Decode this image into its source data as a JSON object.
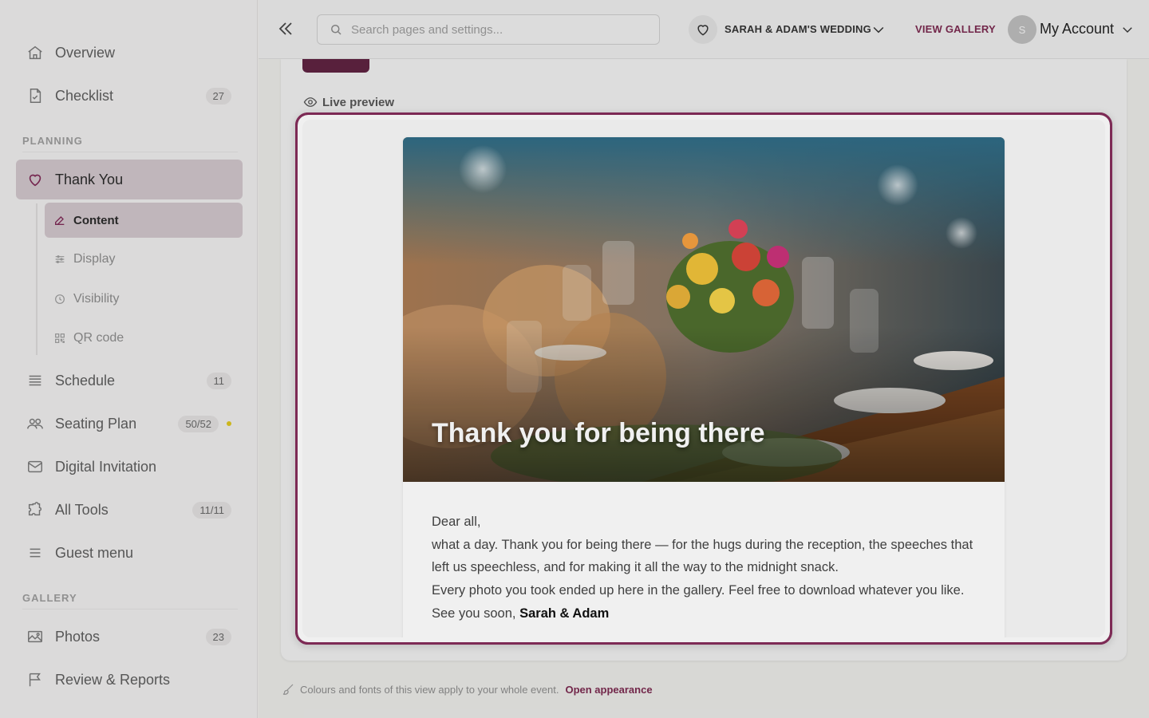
{
  "sidebar": {
    "items": [
      {
        "label": "Overview",
        "icon": "home-icon"
      },
      {
        "label": "Checklist",
        "icon": "checklist-icon",
        "badge": "27"
      },
      {
        "label": "Thank You",
        "icon": "heart-icon"
      },
      {
        "label": "Schedule",
        "icon": "list-icon",
        "badge": "11"
      },
      {
        "label": "Seating Plan",
        "icon": "people-icon",
        "badge": "50/52"
      },
      {
        "label": "Digital Invitation",
        "icon": "envelope-icon"
      },
      {
        "label": "All Tools",
        "icon": "puzzle-icon",
        "badge": "11/11"
      },
      {
        "label": "Guest menu",
        "icon": "menu-icon"
      },
      {
        "label": "Photos",
        "icon": "image-icon",
        "badge": "23"
      },
      {
        "label": "Review & Reports",
        "icon": "flag-icon"
      }
    ],
    "sections": {
      "planning": "PLANNING",
      "gallery": "GALLERY"
    },
    "sub_items": [
      {
        "label": "Content",
        "icon": "edit-icon"
      },
      {
        "label": "Display",
        "icon": "sliders-icon"
      },
      {
        "label": "Visibility",
        "icon": "clock-icon"
      },
      {
        "label": "QR code",
        "icon": "qr-icon"
      }
    ]
  },
  "topbar": {
    "search_placeholder": "Search pages and settings...",
    "event_name": "SARAH & ADAM'S WEDDING",
    "view_gallery": "VIEW GALLERY",
    "avatar_initial": "S",
    "account_label": "My Account"
  },
  "preview": {
    "label": "Live preview",
    "hero_title": "Thank you for being there",
    "greeting": "Dear all,",
    "paragraph1": "what a day. Thank you for being there — for the hugs during the reception, the speeches that left us speechless, and for making it all the way to the midnight snack.",
    "paragraph2": "Every photo you took ended up here in the gallery. Feel free to download whatever you like.",
    "signoff_prefix": "See you soon,",
    "signoff_names": "Sarah & Adam"
  },
  "footer": {
    "note": "Colours and fonts of this view apply to your whole event.",
    "link": "Open appearance"
  },
  "colors": {
    "accent": "#7d2a55",
    "active_bg": "#cdc2c7",
    "status_dot": "#d9c21f"
  }
}
